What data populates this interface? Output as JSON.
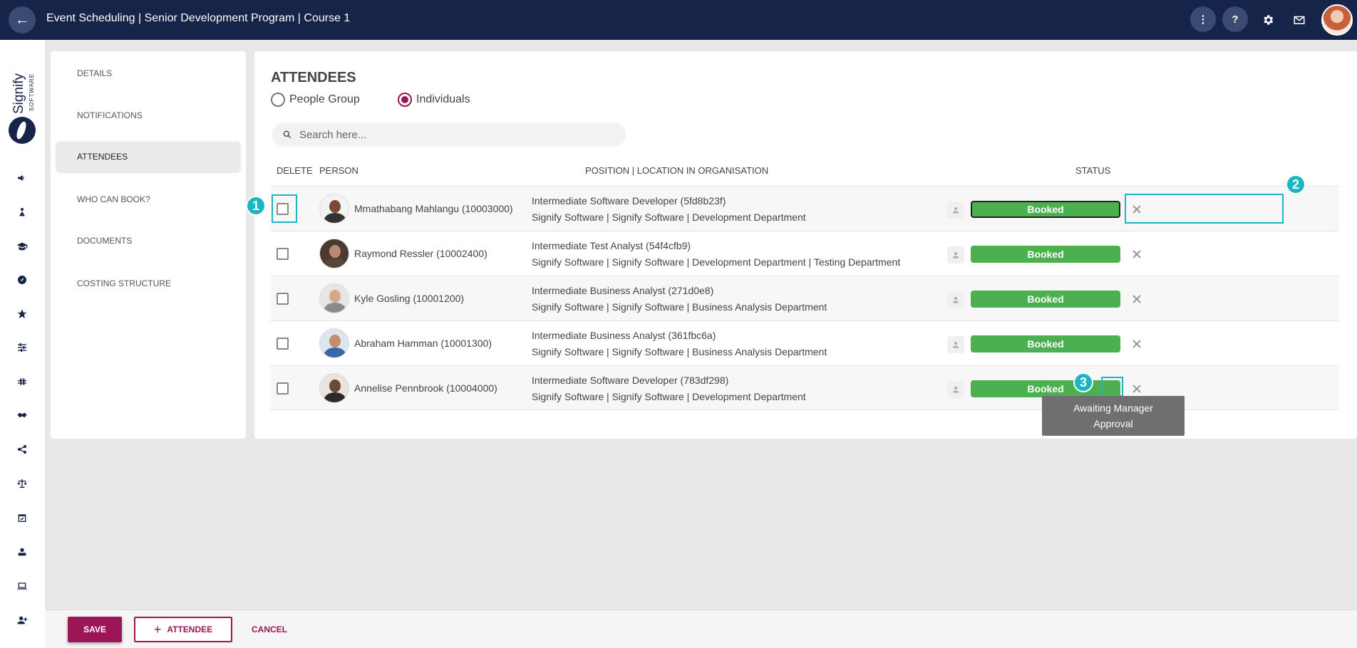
{
  "header": {
    "title": "Event Scheduling | Senior Development Program | Course 1"
  },
  "logo": {
    "main": "Signify",
    "sub": "SOFTWARE"
  },
  "sidenav": {
    "items": [
      {
        "label": "DETAILS"
      },
      {
        "label": "NOTIFICATIONS"
      },
      {
        "label": "ATTENDEES",
        "active": true
      },
      {
        "label": "WHO CAN BOOK?"
      },
      {
        "label": "DOCUMENTS"
      },
      {
        "label": "COSTING STRUCTURE"
      }
    ]
  },
  "main": {
    "title": "ATTENDEES",
    "radio_people_group": "People Group",
    "radio_individuals": "Individuals",
    "selected_radio": "Individuals",
    "search_placeholder": "Search here...",
    "columns": {
      "delete": "DELETE",
      "person": "PERSON",
      "position": "POSITION | LOCATION IN ORGANISATION",
      "status": "STATUS"
    },
    "rows": [
      {
        "name": "Mmathabang Mahlangu (10003000)",
        "position": "Intermediate Software Developer (5fd8b23f)",
        "location": "Signify Software | Signify Software | Development Department",
        "status": "Booked"
      },
      {
        "name": "Raymond Ressler (10002400)",
        "position": "Intermediate Test Analyst (54f4cfb9)",
        "location": "Signify Software | Signify Software | Development Department | Testing Department",
        "status": "Booked"
      },
      {
        "name": "Kyle Gosling (10001200)",
        "position": "Intermediate Business Analyst (271d0e8)",
        "location": "Signify Software | Signify Software | Business Analysis Department",
        "status": "Booked"
      },
      {
        "name": "Abraham Hamman (10001300)",
        "position": "Intermediate Business Analyst (361fbc6a)",
        "location": "Signify Software | Signify Software | Business Analysis Department",
        "status": "Booked"
      },
      {
        "name": "Annelise Pennbrook (10004000)",
        "position": "Intermediate Software Developer (783df298)",
        "location": "Signify Software | Signify Software | Development Department",
        "status": "Booked"
      }
    ],
    "tooltip": "Awaiting Manager Approval",
    "callouts": [
      "1",
      "2",
      "3"
    ]
  },
  "footer": {
    "save": "SAVE",
    "add_attendee": "ATTENDEE",
    "cancel": "CANCEL"
  },
  "colors": {
    "header_bg": "#16244a",
    "accent": "#9c1556",
    "booked": "#4caf50",
    "callout": "#1bb5c4"
  },
  "icons": {
    "top": [
      "more-vert-icon",
      "help-icon",
      "gear-icon",
      "mail-icon"
    ],
    "rail": [
      "megaphone-icon",
      "training-icon",
      "graduation-cap-icon",
      "dashboard-icon",
      "star-icon",
      "sliders-icon",
      "tune-icon",
      "handshake-icon",
      "network-icon",
      "scales-icon",
      "calendar-check-icon",
      "certificate-icon",
      "laptop-icon",
      "add-user-icon"
    ]
  }
}
